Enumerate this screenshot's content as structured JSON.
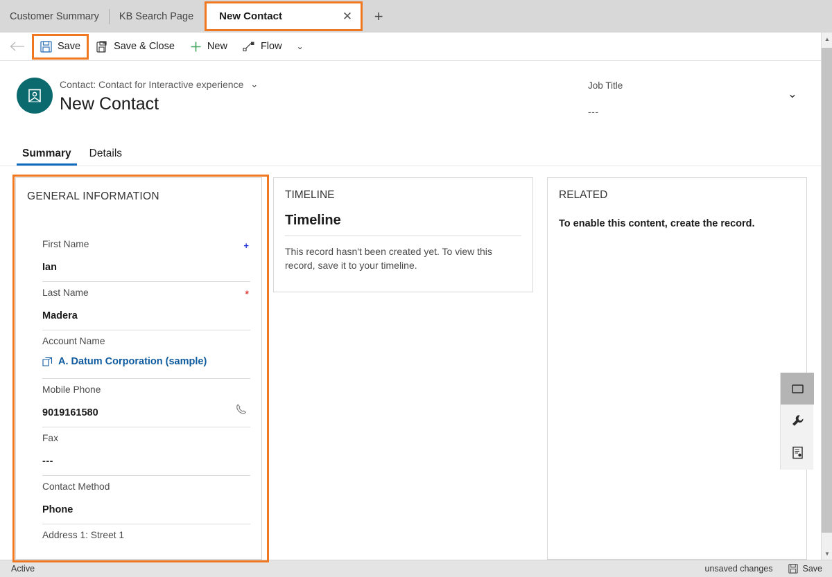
{
  "tabs": {
    "items": [
      {
        "label": "Customer Summary",
        "active": false
      },
      {
        "label": "KB Search Page",
        "active": false
      },
      {
        "label": "New Contact",
        "active": true
      }
    ],
    "close_glyph": "✕",
    "new_tab_glyph": "+"
  },
  "commandbar": {
    "back_glyph": "←",
    "save_label": "Save",
    "save_close_label": "Save & Close",
    "new_label": "New",
    "flow_label": "Flow",
    "overflow_glyph": "⌄"
  },
  "record_header": {
    "entity_line": "Contact: Contact for Interactive experience",
    "entity_chevron": "⌄",
    "title": "New Contact",
    "job_title_label": "Job Title",
    "job_title_value": "---",
    "expand_chevron": "⌄"
  },
  "form_tabs": {
    "items": [
      {
        "label": "Summary",
        "selected": true
      },
      {
        "label": "Details",
        "selected": false
      }
    ]
  },
  "general_information": {
    "title": "GENERAL INFORMATION",
    "fields": [
      {
        "label": "First Name",
        "value": "Ian",
        "required_marker": "+",
        "marker_type": "recommended"
      },
      {
        "label": "Last Name",
        "value": "Madera",
        "required_marker": "*",
        "marker_type": "required"
      },
      {
        "label": "Account Name",
        "value": "A. Datum Corporation (sample)",
        "value_type": "lookup-link"
      },
      {
        "label": "Mobile Phone",
        "value": "9019161580",
        "trailing_icon": "phone-icon"
      },
      {
        "label": "Fax",
        "value": "---"
      },
      {
        "label": "Contact Method",
        "value": "Phone"
      },
      {
        "label": "Address 1: Street 1",
        "value": ""
      }
    ]
  },
  "timeline": {
    "section_label": "TIMELINE",
    "title": "Timeline",
    "message": "This record hasn't been created yet.  To view this record, save it to your timeline."
  },
  "related": {
    "section_label": "RELATED",
    "message": "To enable this content, create the record.",
    "rail_items": [
      {
        "icon": "related-folder-icon",
        "selected": true
      },
      {
        "icon": "wrench-icon",
        "selected": false
      },
      {
        "icon": "document-icon",
        "selected": false
      }
    ]
  },
  "statusbar": {
    "state": "Active",
    "unsaved_text": "unsaved changes",
    "save_label": "Save"
  },
  "colors": {
    "highlight_orange": "#f07820",
    "accent_blue": "#0d6abf",
    "avatar_teal": "#0b6a6e",
    "link_blue": "#0d5a9e",
    "required_red": "#e04040",
    "recommended_blue": "#2a3cd6",
    "new_green": "#3ea35a"
  }
}
